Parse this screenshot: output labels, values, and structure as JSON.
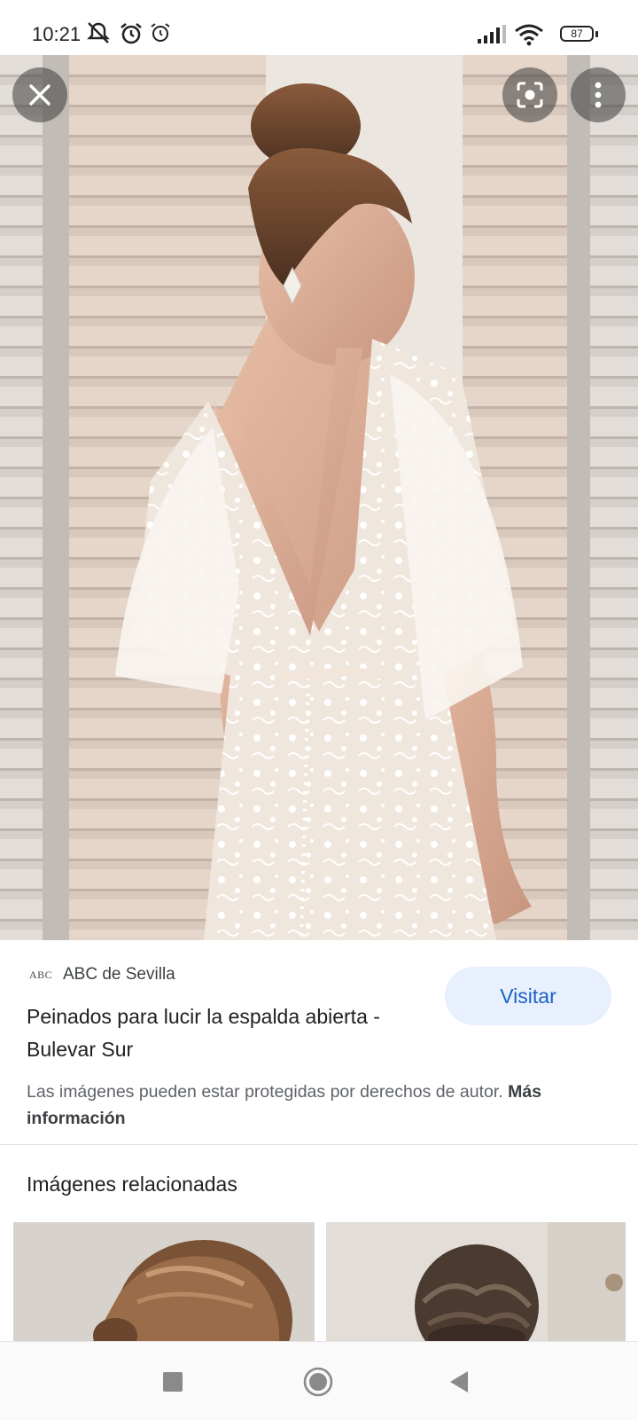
{
  "status_bar": {
    "time": "10:21",
    "battery": "87"
  },
  "hero": {
    "icons": [
      "close-icon",
      "lens-icon",
      "more-vert-icon"
    ]
  },
  "source": {
    "logo": "ABC",
    "name": "ABC de Sevilla"
  },
  "result": {
    "title": "Peinados para lucir la espalda abierta - Bulevar Sur",
    "visit_label": "Visitar",
    "copyright_text": "Las imágenes pueden estar protegidas por derechos de autor.",
    "more_info_label": "Más información"
  },
  "related": {
    "heading": "Imágenes relacionadas"
  },
  "colors": {
    "accent": "#1a62c4",
    "button_bg": "#e8f0fe"
  }
}
